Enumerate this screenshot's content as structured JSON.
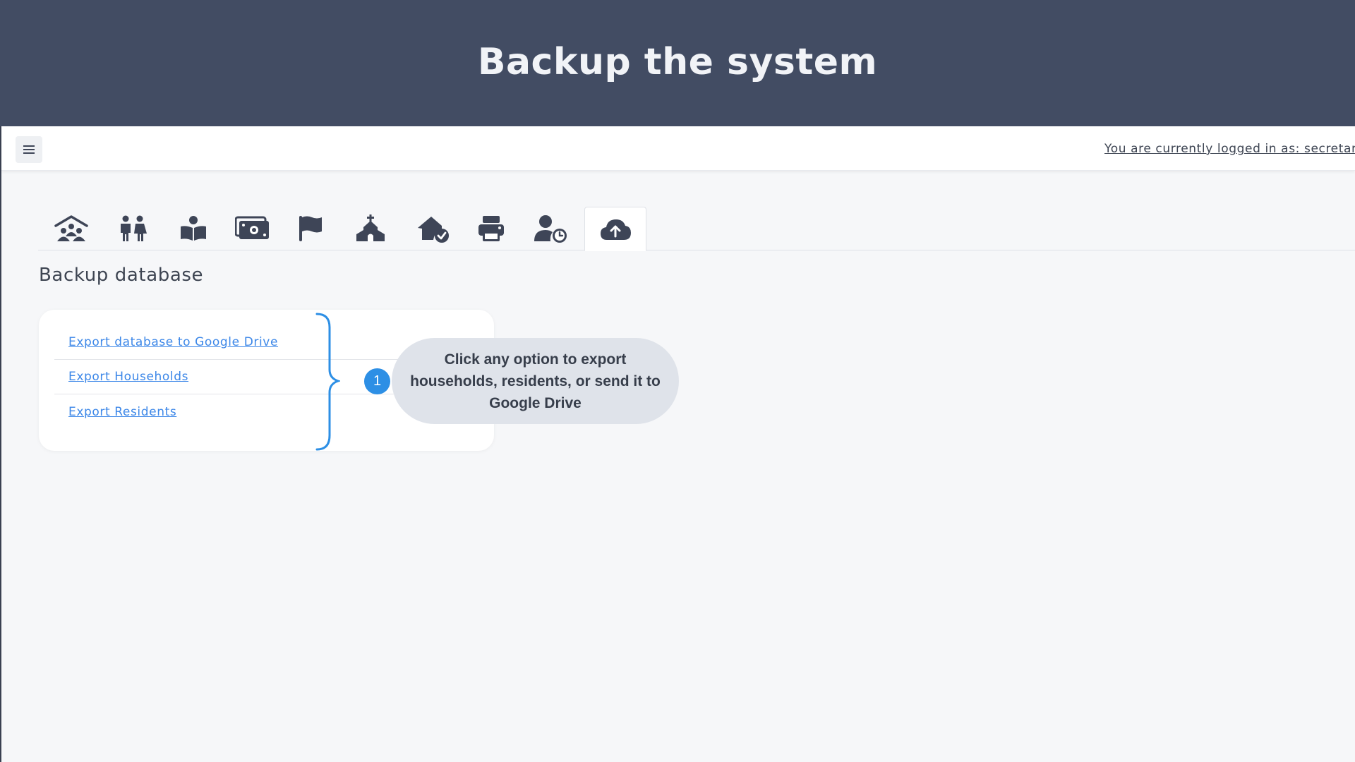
{
  "banner": {
    "title": "Backup the system"
  },
  "topbar": {
    "menu_icon": "hamburger-menu-icon",
    "login_text": "You are currently logged in as: secretar"
  },
  "tabs": [
    {
      "icon": "community-icon",
      "active": false
    },
    {
      "icon": "residents-icon",
      "active": false
    },
    {
      "icon": "reader-icon",
      "active": false
    },
    {
      "icon": "money-icon",
      "active": false
    },
    {
      "icon": "flag-icon",
      "active": false
    },
    {
      "icon": "church-icon",
      "active": false
    },
    {
      "icon": "house-check-icon",
      "active": false
    },
    {
      "icon": "printer-icon",
      "active": false
    },
    {
      "icon": "user-clock-icon",
      "active": false
    },
    {
      "icon": "cloud-upload-icon",
      "active": true
    }
  ],
  "section": {
    "title": "Backup database"
  },
  "options": [
    {
      "label": "Export database to Google Drive"
    },
    {
      "label": "Export Households"
    },
    {
      "label": "Export Residents"
    }
  ],
  "annotation": {
    "step": "1",
    "text": "Click any option to export households, residents, or send it to Google Drive"
  },
  "colors": {
    "banner": "#424c63",
    "icon": "#3e4557",
    "link": "#3c87e8",
    "badge": "#2d8fe5",
    "callout": "#dfe3ea"
  }
}
